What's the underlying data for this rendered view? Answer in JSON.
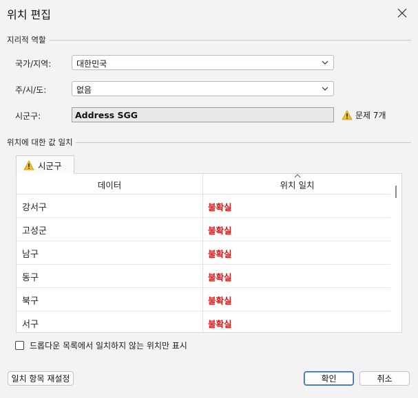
{
  "window": {
    "title": "위치 편집"
  },
  "geo_section": {
    "label": "지리적 역할",
    "country_label": "국가/지역:",
    "country_value": "대한민국",
    "state_label": "주/시/도:",
    "state_value": "없음",
    "city_label": "시군구:",
    "city_value": "Address SGG",
    "issues_text": "문제 7개"
  },
  "match_section": {
    "label": "위치에 대한 값 일치",
    "tab_label": "시군구",
    "columns": {
      "data": "데이터",
      "match": "위치 일치"
    },
    "rows": [
      {
        "data": "강서구",
        "match": "불확실"
      },
      {
        "data": "고성군",
        "match": "불확실"
      },
      {
        "data": "남구",
        "match": "불확실"
      },
      {
        "data": "동구",
        "match": "불확실"
      },
      {
        "data": "북구",
        "match": "불확실"
      },
      {
        "data": "서구",
        "match": "불확실"
      }
    ]
  },
  "filter_checkbox_label": "드롭다운 목록에서 일치하지 않는 위치만 표시",
  "buttons": {
    "reset": "일치 항목 재설정",
    "ok": "확인",
    "cancel": "취소"
  },
  "colors": {
    "warning": "#f0c020",
    "uncertain": "#d41a1a",
    "primary_border": "#2f63b8"
  }
}
